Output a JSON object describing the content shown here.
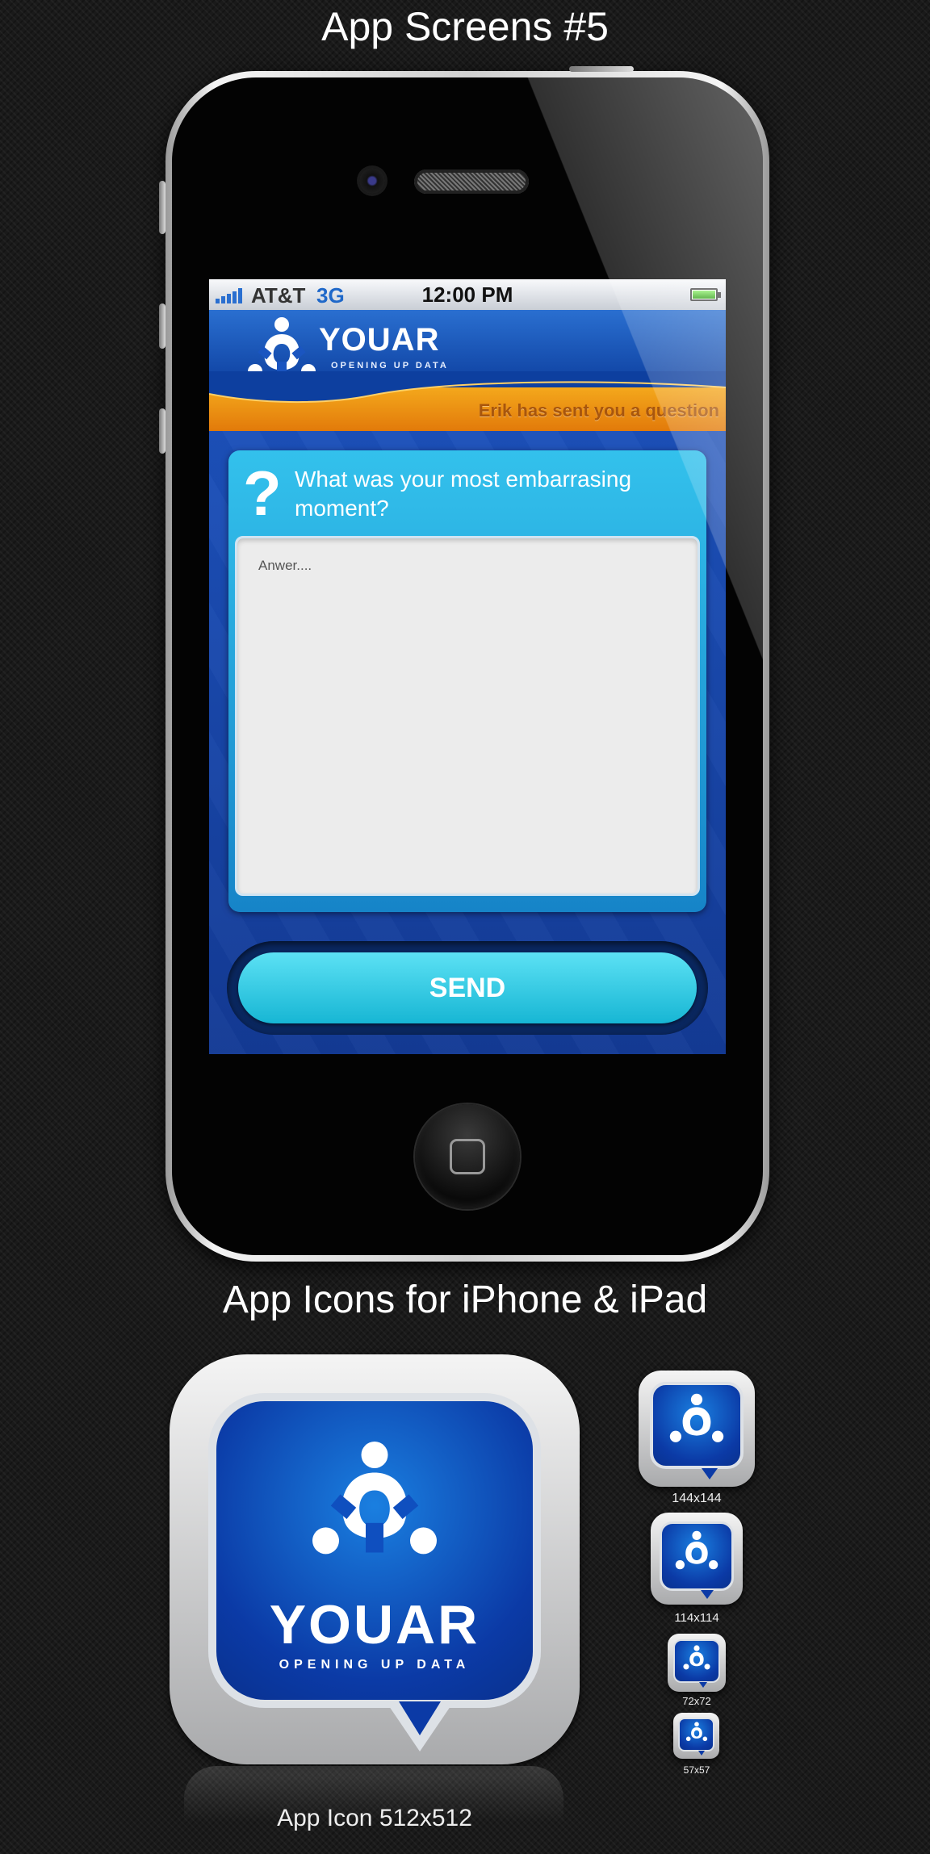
{
  "page": {
    "title": "App Screens #5",
    "icons_title": "App Icons for iPhone & iPad"
  },
  "colors": {
    "brand_blue": "#1a50b9",
    "notify_orange": "#f09a16",
    "card_cyan": "#33c1ec",
    "send_cyan": "#17b6d4"
  },
  "status_bar": {
    "carrier": "AT&T",
    "network": "3G",
    "time": "12:00 PM",
    "battery_icon": "battery-full-icon",
    "signal_icon": "signal-bars-icon"
  },
  "app": {
    "brand_name": "YOUAR",
    "tagline": "OPENING UP DATA",
    "notification": "Erik has sent you a question",
    "question_icon": "?",
    "question": "What was your most embarrasing moment?",
    "answer_placeholder": "Anwer....",
    "answer_value": "",
    "send_label": "SEND"
  },
  "icons": {
    "large": {
      "brand": "YOUAR",
      "tagline": "OPENING UP DATA",
      "caption": "App Icon 512x512"
    },
    "sizes": [
      {
        "caption": "144x144"
      },
      {
        "caption": "114x114"
      },
      {
        "caption": "72x72"
      },
      {
        "caption": "57x57"
      }
    ]
  }
}
